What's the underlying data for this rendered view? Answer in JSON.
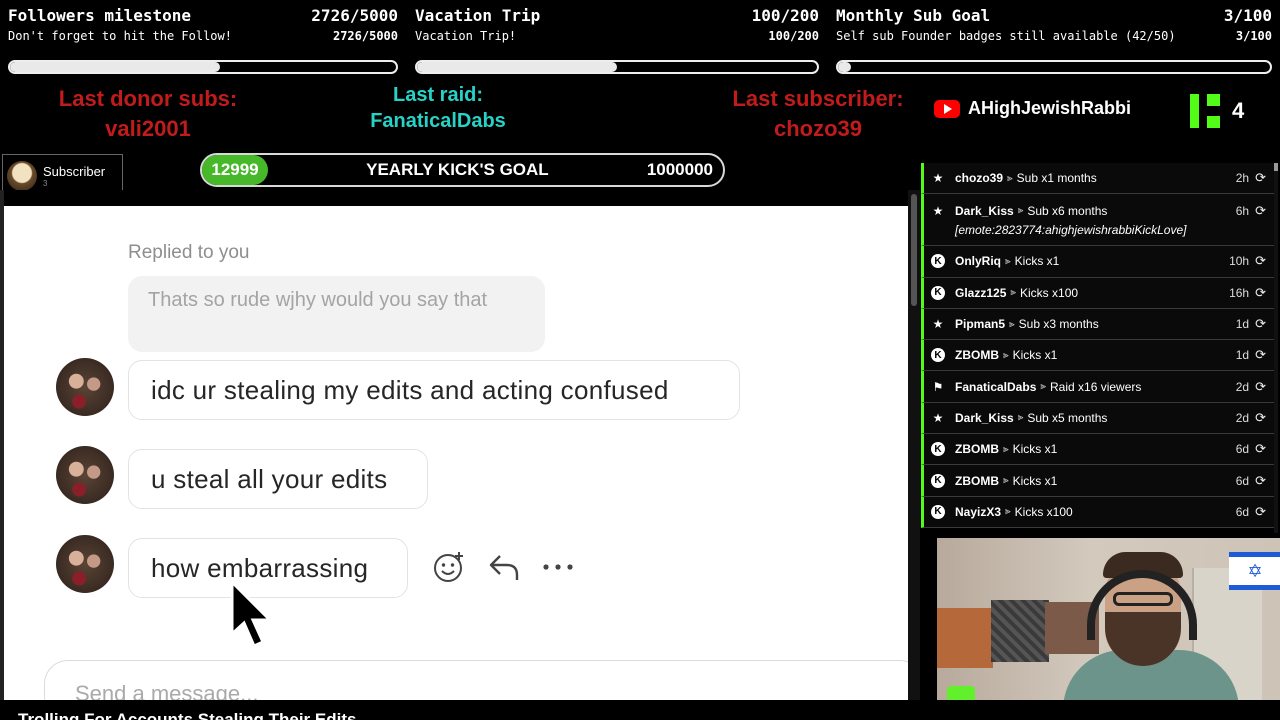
{
  "goals": [
    {
      "title": "Followers milestone",
      "value": "2726/5000",
      "subtitle": "Don't forget to hit the Follow!",
      "subvalue": "2726/5000",
      "progress": 0.545
    },
    {
      "title": "Vacation Trip",
      "value": "100/200",
      "subtitle": "Vacation Trip!",
      "subvalue": "100/200",
      "progress": 0.5
    },
    {
      "title": "Monthly Sub Goal",
      "value": "3/100",
      "subtitle": "Self sub Founder badges still available (42/50)",
      "subvalue": "3/100",
      "progress": 0.03
    }
  ],
  "last": {
    "donor_label": "Last donor subs:",
    "donor_name": "vali2001",
    "raid_label": "Last raid:",
    "raid_name": "FanaticalDabs",
    "sub_label": "Last subscriber:",
    "sub_name": "chozo39"
  },
  "youtube": {
    "channel": "AHighJewishRabbi",
    "icon": "youtube-icon"
  },
  "kick_count": "4",
  "subscriber_badge": {
    "label": "Subscriber",
    "count": "3"
  },
  "kick_goal": {
    "current": "12999",
    "title": "YEARLY KICK'S GOAL",
    "target": "1000000"
  },
  "chat": {
    "replied_label": "Replied to you",
    "quoted_text": "Thats so rude wjhy would you say that",
    "messages": [
      {
        "text": "idc ur stealing my edits and acting confused"
      },
      {
        "text": "u steal all your edits"
      },
      {
        "text": "how embarrassing"
      }
    ],
    "composer_placeholder": "Send a message..."
  },
  "events": [
    {
      "icon": "star-icon",
      "user": "chozo39",
      "action": "Sub x1 months",
      "ago": "2h"
    },
    {
      "icon": "star-icon",
      "user": "Dark_Kiss",
      "action": "Sub x6 months",
      "ago": "6h",
      "note": "[emote:2823774:ahighjewishrabbiKickLove]"
    },
    {
      "icon": "kick-icon",
      "user": "OnlyRiq",
      "action": "Kicks x1",
      "ago": "10h"
    },
    {
      "icon": "kick-icon",
      "user": "Glazz125",
      "action": "Kicks x100",
      "ago": "16h"
    },
    {
      "icon": "star-icon",
      "user": "Pipman5",
      "action": "Sub x3 months",
      "ago": "1d"
    },
    {
      "icon": "kick-icon",
      "user": "ZBOMB",
      "action": "Kicks x1",
      "ago": "1d"
    },
    {
      "icon": "raid-icon",
      "user": "FanaticalDabs",
      "action": "Raid x16 viewers",
      "ago": "2d"
    },
    {
      "icon": "star-icon",
      "user": "Dark_Kiss",
      "action": "Sub x5 months",
      "ago": "2d"
    },
    {
      "icon": "kick-icon",
      "user": "ZBOMB",
      "action": "Kicks x1",
      "ago": "6d"
    },
    {
      "icon": "kick-icon",
      "user": "ZBOMB",
      "action": "Kicks x1",
      "ago": "6d"
    },
    {
      "icon": "kick-icon",
      "user": "NayizX3",
      "action": "Kicks x100",
      "ago": "6d"
    }
  ],
  "ticker": "Trolling For Accounts Stealing Their Edits",
  "colors": {
    "kick_green": "#53fc18",
    "red": "#c21b1b",
    "teal": "#26d3c6",
    "goal_green": "#46b82a"
  }
}
